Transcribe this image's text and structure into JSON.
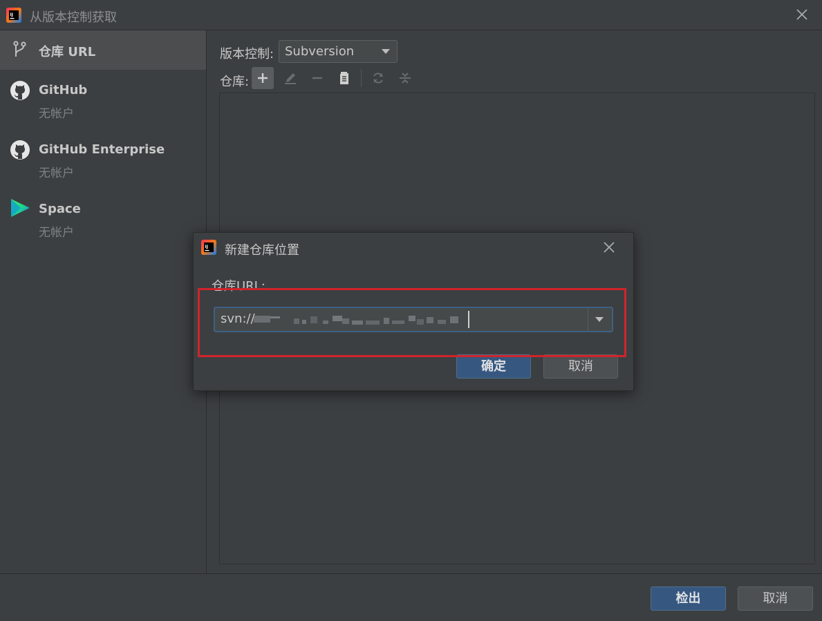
{
  "window": {
    "title": "从版本控制获取",
    "close_icon": "close-icon"
  },
  "sidebar": {
    "items": [
      {
        "label": "仓库 URL",
        "icon": "vcs-branch-icon",
        "sub": "",
        "selected": true
      },
      {
        "label": "GitHub",
        "icon": "github-icon",
        "sub": "无帐户"
      },
      {
        "label": "GitHub Enterprise",
        "icon": "github-icon",
        "sub": "无帐户"
      },
      {
        "label": "Space",
        "icon": "space-icon",
        "sub": "无帐户"
      }
    ]
  },
  "main": {
    "vcs_label": "版本控制:",
    "vcs_value": "Subversion",
    "repo_label": "仓库:",
    "toolbar": [
      "add-icon",
      "edit-icon",
      "remove-icon",
      "copy-icon",
      "refresh-icon",
      "collapse-icon"
    ]
  },
  "dialog": {
    "title": "新建仓库位置",
    "url_label": "仓库URL:",
    "url_value": "svn://",
    "ok_label": "确定",
    "cancel_label": "取消"
  },
  "footer": {
    "checkout_label": "检出",
    "cancel_label": "取消"
  },
  "colors": {
    "background": "#3c3f41",
    "primary_button": "#365880",
    "highlight": "#d0242b",
    "focus_border": "#3d6185"
  }
}
